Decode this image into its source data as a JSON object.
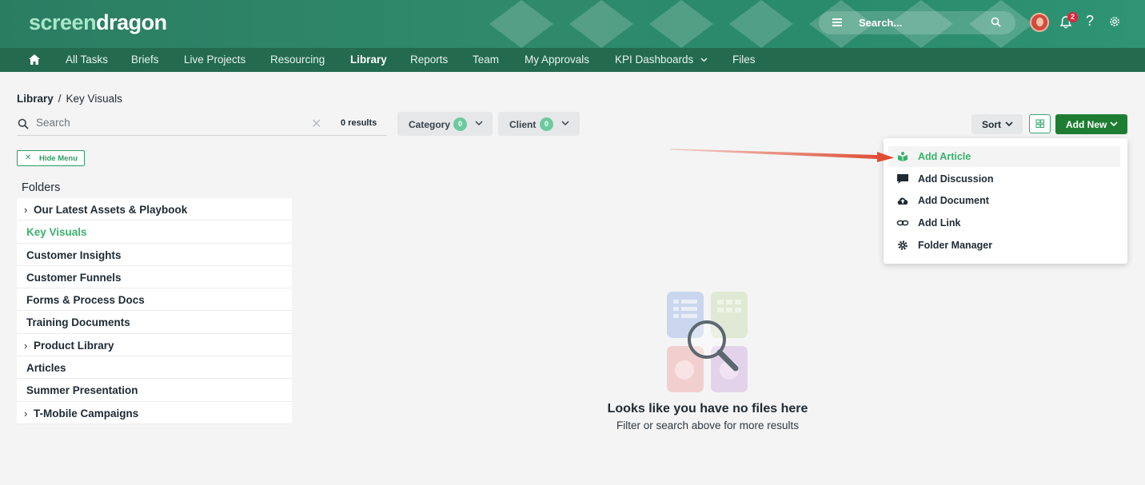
{
  "app": {
    "logo_part1": "screen",
    "logo_part2": "dragon"
  },
  "header": {
    "search_placeholder": "Search...",
    "notification_count": "2",
    "help_label": "?"
  },
  "nav": {
    "items": [
      "All Tasks",
      "Briefs",
      "Live Projects",
      "Resourcing",
      "Library",
      "Reports",
      "Team",
      "My Approvals",
      "KPI Dashboards",
      "Files"
    ],
    "active": "Library"
  },
  "breadcrumb": {
    "root": "Library",
    "separator": "/",
    "current": "Key Visuals"
  },
  "search": {
    "placeholder": "Search",
    "results": "0 results"
  },
  "filters": [
    {
      "label": "Category",
      "count": "0"
    },
    {
      "label": "Client",
      "count": "0"
    }
  ],
  "toolbar": {
    "sort_label": "Sort",
    "add_new_label": "Add New"
  },
  "dropdown": {
    "items": [
      {
        "label": "Add Article",
        "icon": "article-icon"
      },
      {
        "label": "Add Discussion",
        "icon": "discussion-icon"
      },
      {
        "label": "Add Document",
        "icon": "cloud-upload-icon"
      },
      {
        "label": "Add Link",
        "icon": "link-icon"
      },
      {
        "label": "Folder Manager",
        "icon": "gear-icon"
      }
    ]
  },
  "sidebar": {
    "hide_menu_label": "Hide Menu",
    "folders_title": "Folders",
    "folders": [
      {
        "label": "Our Latest Assets & Playbook",
        "expandable": true
      },
      {
        "label": "Key Visuals",
        "expandable": false
      },
      {
        "label": "Customer Insights",
        "expandable": false
      },
      {
        "label": "Customer Funnels",
        "expandable": false
      },
      {
        "label": "Forms & Process Docs",
        "expandable": false
      },
      {
        "label": "Training Documents",
        "expandable": false
      },
      {
        "label": "Product Library",
        "expandable": true
      },
      {
        "label": "Articles",
        "expandable": false
      },
      {
        "label": "Summer Presentation",
        "expandable": false
      },
      {
        "label": "T-Mobile Campaigns",
        "expandable": true
      }
    ]
  },
  "empty_state": {
    "title": "Looks like you have no files here",
    "subtitle": "Filter or search above for more results"
  },
  "colors": {
    "brand_green": "#2b7d62",
    "nav_green": "#236a4f",
    "accent_green": "#3bb26f",
    "add_button": "#1e7d32",
    "annotation_arrow": "#e0452c"
  }
}
